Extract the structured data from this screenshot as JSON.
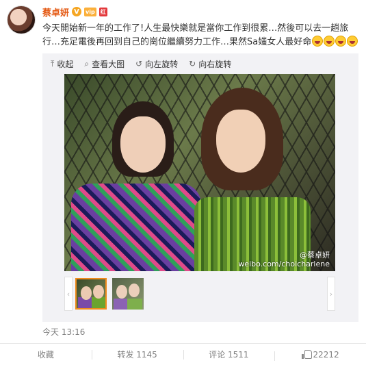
{
  "post": {
    "author": "蔡卓妍",
    "badges": [
      "V",
      "vip",
      "红包"
    ],
    "text": "今天開始新一年的工作了!人生最快樂就是當你工作到很累…然後可以去一趟旅行…充足電後再回到自己的崗位繼續努力工作…果然Sa媸女人最好命",
    "emoji_count": 4,
    "timestamp": "今天 13:16"
  },
  "media": {
    "toolbar": {
      "collapse": "收起",
      "view_large": "查看大图",
      "rotate_left": "向左旋转",
      "rotate_right": "向右旋转"
    },
    "watermark_handle": "@蔡卓妍",
    "watermark_url": "weibo.com/choicharlene",
    "thumbnail_count": 2,
    "selected_thumbnail": 1
  },
  "actions": {
    "favorite": "收藏",
    "repost": "转发 1145",
    "comment": "评论 1511",
    "like_count": "22212"
  },
  "colors": {
    "author_name": "#e55b16",
    "badge_v": "#f5a623",
    "selected_thumb_border": "#f08c1d",
    "media_bg": "#f2f2f5"
  },
  "icons": [
    "collapse-icon",
    "zoom-icon",
    "rotate-left-icon",
    "rotate-right-icon",
    "like-icon",
    "grin-emoji-icon"
  ]
}
